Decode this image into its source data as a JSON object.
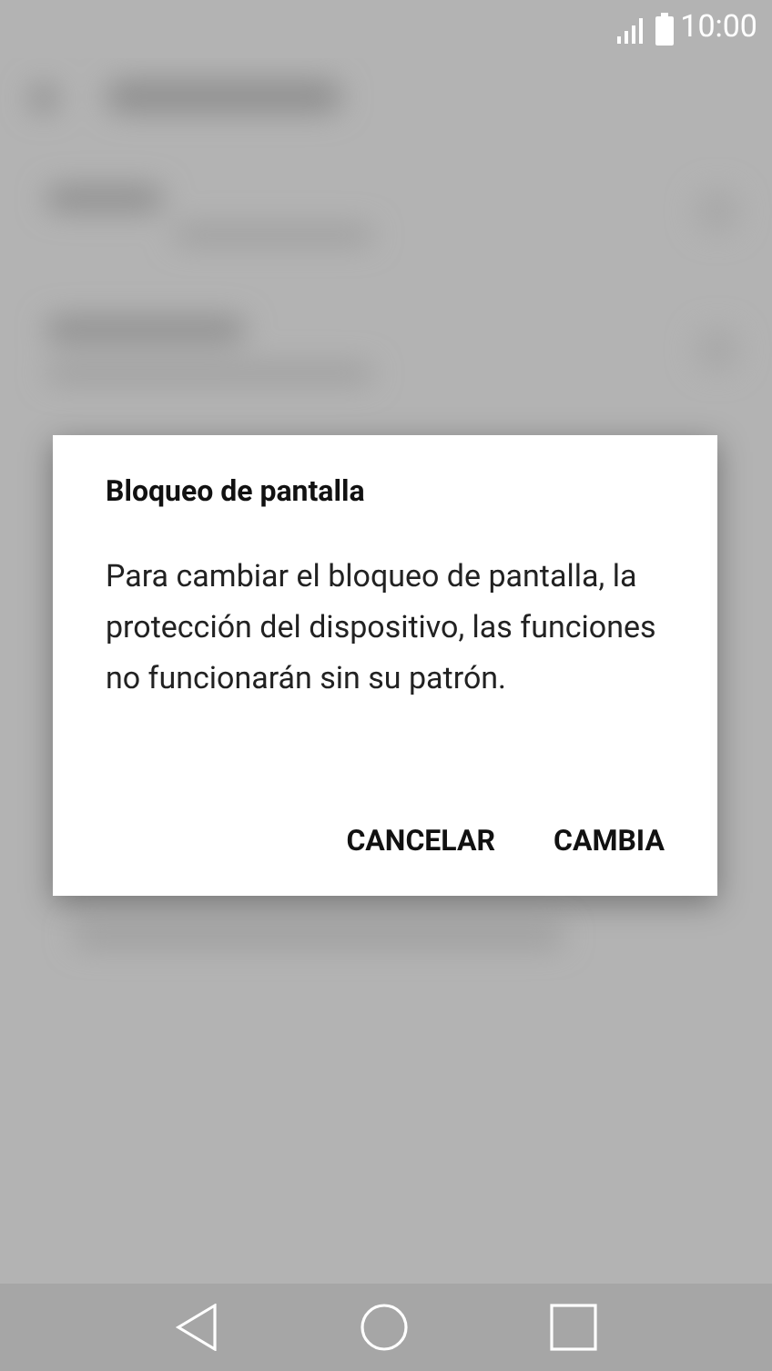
{
  "status_bar": {
    "time": "10:00"
  },
  "dialog": {
    "title": "Bloqueo de pantalla",
    "message": "Para cambiar el bloqueo de pantalla, la protección del dispositivo, las funciones no funcionarán sin su patrón.",
    "buttons": [
      "CANCELAR",
      "CAMBIA"
    ]
  }
}
